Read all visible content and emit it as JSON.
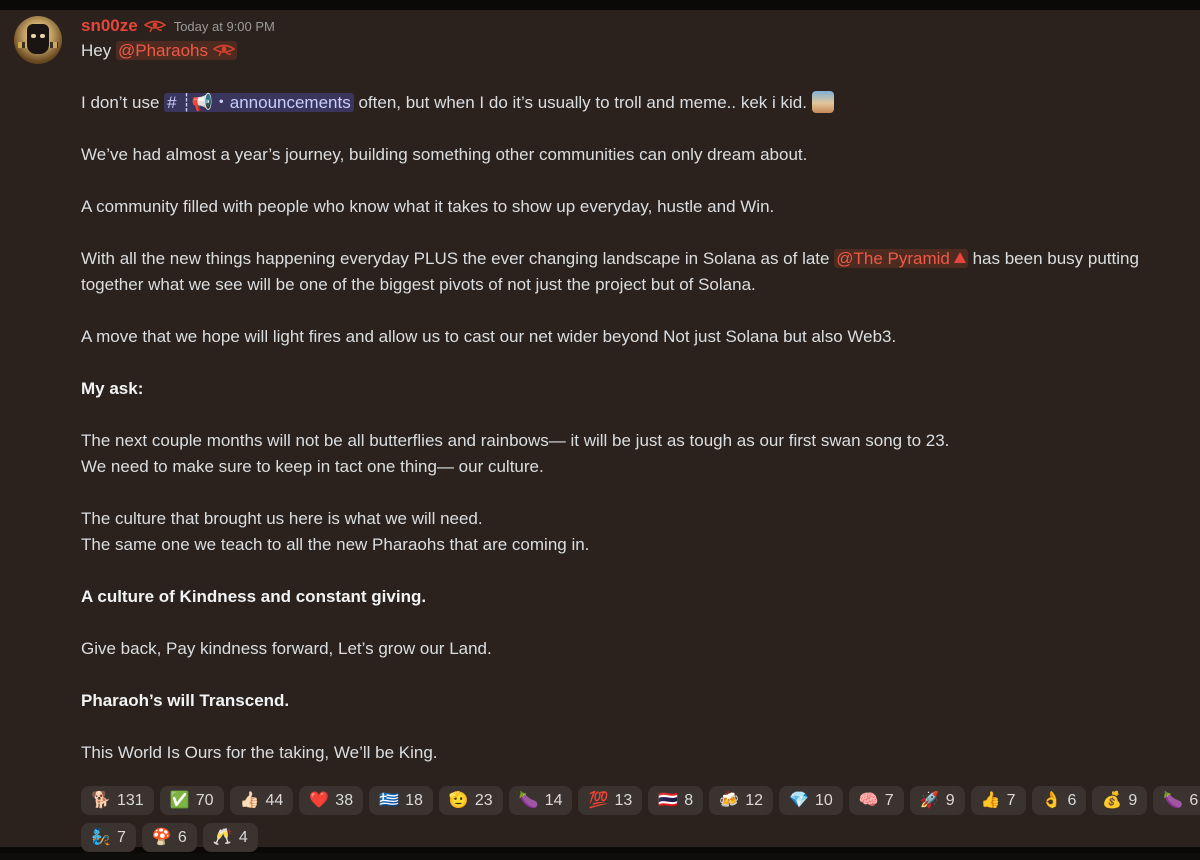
{
  "message": {
    "username": "sn00ze",
    "username_color": "#e8453a",
    "role_icon": "eye-of-horus-icon",
    "timestamp": "Today at 9:00 PM",
    "greeting_prefix": "Hey ",
    "greeting_mention": "@Pharaohs",
    "line1_prefix": "I don’t use ",
    "line1_channel": "# ┊📢・announcements",
    "line1_suffix": " often, but when I do it’s usually to troll and meme.. kek i kid.",
    "line2": "We’ve had almost a year’s journey, building something other communities can only dream about.",
    "line3": "A community filled with people who know what it takes to show up everyday, hustle and Win.",
    "line4_prefix": "With all the new things happening everyday PLUS the ever changing landscape in Solana as of late ",
    "line4_mention": "@The Pyramid",
    "line4_suffix": " has been busy putting together what we see will be one of the biggest pivots of not just the project but of Solana.",
    "line5": "A move that we hope will light fires and allow us to cast our net wider beyond Not just Solana but also Web3.",
    "line6": "My ask:",
    "line7a": "The next couple months will not be all butterflies and rainbows— it will be just as tough as our first swan song to 23.",
    "line7b": "We need to make sure to keep in tact one thing— our culture.",
    "line8a": "The culture that brought us here is what we will need.",
    "line8b": "The same one we teach to all the new Pharaohs that are coming in.",
    "line9": "A culture of Kindness and constant giving.",
    "line10": "Give back, Pay kindness forward, Let’s grow our Land.",
    "line11": "Pharaoh’s will Transcend.",
    "line12": "This World Is Ours for the taking, We’ll be King."
  },
  "reactions_row1": [
    {
      "emoji": "🐕",
      "count": "131"
    },
    {
      "emoji": "✅",
      "count": "70"
    },
    {
      "emoji": "👍🏻",
      "count": "44"
    },
    {
      "emoji": "❤️",
      "count": "38"
    },
    {
      "emoji": "🇬🇷",
      "count": "18"
    },
    {
      "emoji": "🫡",
      "count": "23"
    },
    {
      "emoji": "🍆",
      "count": "14"
    },
    {
      "emoji": "💯",
      "count": "13"
    },
    {
      "emoji": "🇹🇭",
      "count": "8"
    },
    {
      "emoji": "🍻",
      "count": "12"
    },
    {
      "emoji": "💎",
      "count": "10"
    },
    {
      "emoji": "🧠",
      "count": "7"
    },
    {
      "emoji": "🚀",
      "count": "9"
    },
    {
      "emoji": "👍",
      "count": "7"
    },
    {
      "emoji": "👌",
      "count": "6"
    },
    {
      "emoji": "💰",
      "count": "9"
    },
    {
      "emoji": "🍆",
      "count": "6"
    }
  ],
  "reactions_row2": [
    {
      "emoji": "🧞",
      "count": "7"
    },
    {
      "emoji": "🍄",
      "count": "6"
    },
    {
      "emoji": "🥂",
      "count": "4"
    }
  ]
}
